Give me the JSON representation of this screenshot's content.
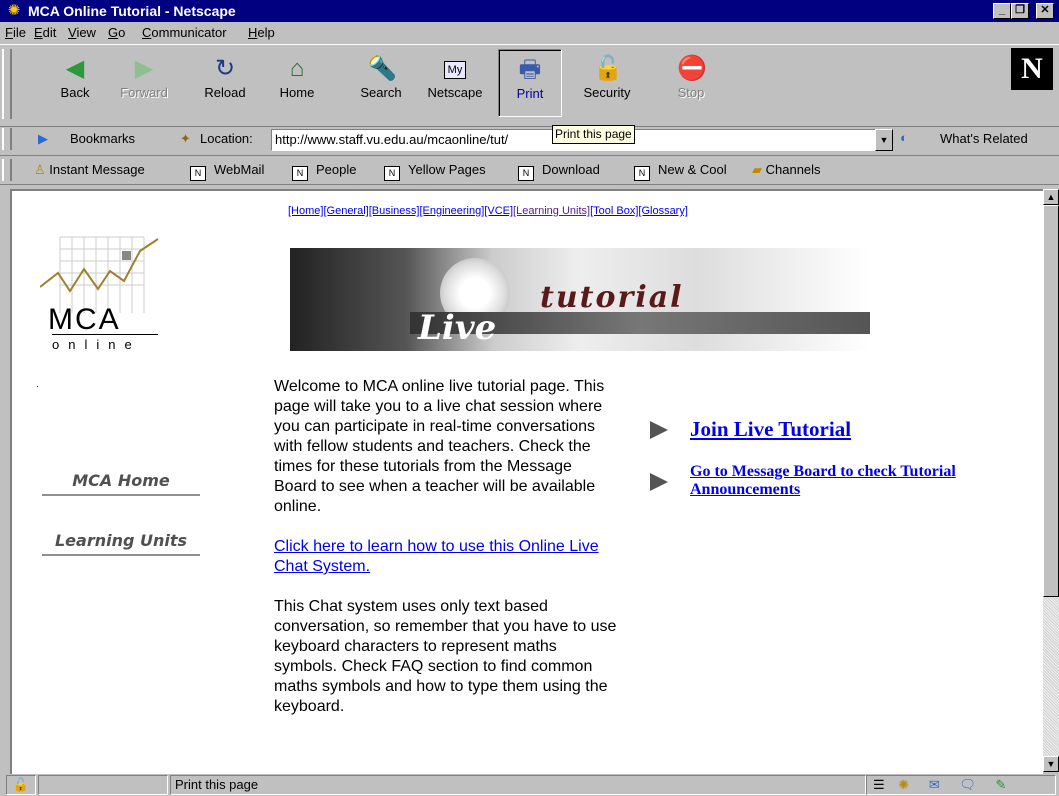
{
  "window": {
    "title": "MCA Online Tutorial - Netscape"
  },
  "menu": [
    {
      "label": "File",
      "u": "F",
      "rest": "ile"
    },
    {
      "label": "Edit",
      "u": "E",
      "rest": "dit"
    },
    {
      "label": "View",
      "u": "V",
      "rest": "iew"
    },
    {
      "label": "Go",
      "u": "G",
      "rest": "o"
    },
    {
      "label": "Communicator",
      "u": "C",
      "rest": "ommunicator"
    },
    {
      "label": "Help",
      "u": "H",
      "rest": "elp"
    }
  ],
  "toolbar": {
    "back": "Back",
    "forward": "Forward",
    "reload": "Reload",
    "home": "Home",
    "search": "Search",
    "netscape": "Netscape",
    "print": "Print",
    "security": "Security",
    "stop": "Stop",
    "my_badge": "My"
  },
  "location": {
    "bookmarks": "Bookmarks",
    "label": "Location:",
    "url": "http://www.staff.vu.edu.au/mcaonline/tut/",
    "whats_related": "What's Related",
    "tooltip": "Print this page"
  },
  "personal": {
    "instant_message": "Instant Message",
    "webmail": "WebMail",
    "people": "People",
    "yellow_pages": "Yellow Pages",
    "download": "Download",
    "new_cool": "New & Cool",
    "channels": "Channels"
  },
  "page": {
    "topnav": [
      "[Home]",
      "[General]",
      "[Business]",
      "[Engineering]",
      "[VCE]",
      "[Learning Units]",
      "[Tool Box]",
      "[Glossary]"
    ],
    "logo_text": "MCA",
    "logo_sub": "online",
    "banner_tutorial": "tutorial",
    "banner_live": "Live",
    "side_home": "MCA Home",
    "side_units": "Learning Units",
    "intro": "Welcome to MCA online live tutorial page. This page will take you to a live chat session where you can participate in real-time conversations with fellow students and teachers. Check the times for these tutorials from the Message Board to see when a teacher will be available online.",
    "howto_link": "Click here to learn how to use this Online Live Chat System.",
    "chat_note": "This Chat system uses only text based conversation, so remember that you have to use keyboard characters to represent maths symbols. Check FAQ section to find common maths symbols and how to type them using the keyboard.",
    "join_link": "Join Live Tutorial",
    "board_link": "Go to Message Board to check Tutorial Announcements"
  },
  "status": {
    "text": "Print this page"
  }
}
